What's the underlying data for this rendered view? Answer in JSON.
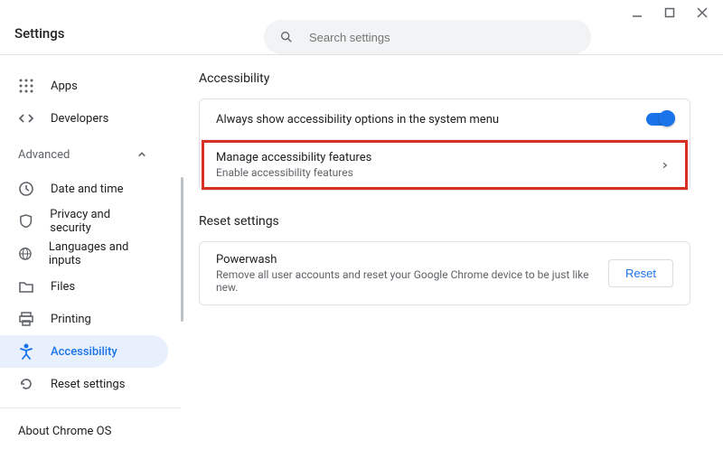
{
  "window": {
    "title": "Settings"
  },
  "search": {
    "placeholder": "Search settings"
  },
  "sidebar": {
    "apps": "Apps",
    "developers": "Developers",
    "advanced_label": "Advanced",
    "items": {
      "datetime": "Date and time",
      "privacy": "Privacy and security",
      "languages": "Languages and inputs",
      "files": "Files",
      "printing": "Printing",
      "accessibility": "Accessibility",
      "reset": "Reset settings"
    },
    "about": "About Chrome OS"
  },
  "content": {
    "accessibility_title": "Accessibility",
    "always_show": "Always show accessibility options in the system menu",
    "manage_title": "Manage accessibility features",
    "manage_sub": "Enable accessibility features",
    "reset_title": "Reset settings",
    "powerwash_title": "Powerwash",
    "powerwash_sub": "Remove all user accounts and reset your Google Chrome device to be just like new.",
    "reset_button": "Reset"
  }
}
